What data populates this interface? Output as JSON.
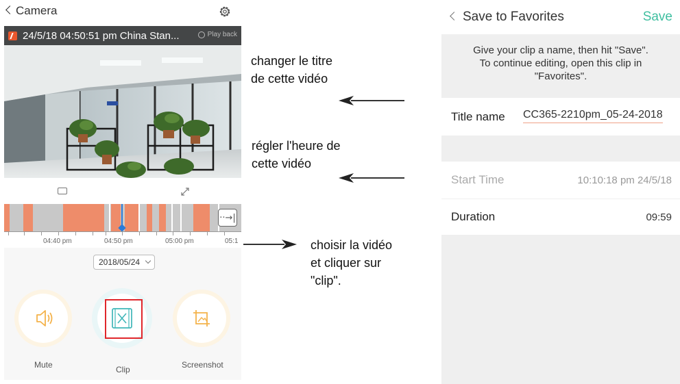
{
  "left_screen": {
    "header": {
      "back_label": "Camera",
      "settings_icon": "gear-icon"
    },
    "video": {
      "timestamp": "24/5/18 04:50:51 pm China Stan...",
      "playback_label": "Play back"
    },
    "timeline": {
      "tick_labels": [
        "04:40 pm",
        "04:50 pm",
        "05:00 pm",
        "05:1"
      ],
      "recorded_color": "#ee8c6a",
      "gap_color": "#c8c8c8",
      "cursor_color": "#2b7bd8",
      "go_end_symbol": "··→|"
    },
    "date_select": {
      "value": "2018/05/24"
    },
    "buttons": {
      "mute": "Mute",
      "clip": "Clip",
      "screenshot": "Screenshot"
    },
    "accent_color": "#f4b24a",
    "highlight_color": "#e0262b"
  },
  "annotations": {
    "title_note": "changer le titre\nde cette vidéo",
    "time_note": "régler l'heure de\ncette vidéo",
    "clip_note": "choisir la vidéo\net cliquer sur\n\"clip\"."
  },
  "right_screen": {
    "header": {
      "title": "Save to Favorites",
      "save_label": "Save"
    },
    "hint": "Give your clip a name, then hit \"Save\".\nTo continue editing, open this clip in\n\"Favorites\".",
    "title_name": {
      "label": "Title name",
      "value": "CC365-2210pm_05-24-2018"
    },
    "start_time": {
      "label": "Start Time",
      "value": "10:10:18 pm 24/5/18"
    },
    "duration": {
      "label": "Duration",
      "value": "09:59"
    },
    "accent_color": "#3fbfa0"
  }
}
